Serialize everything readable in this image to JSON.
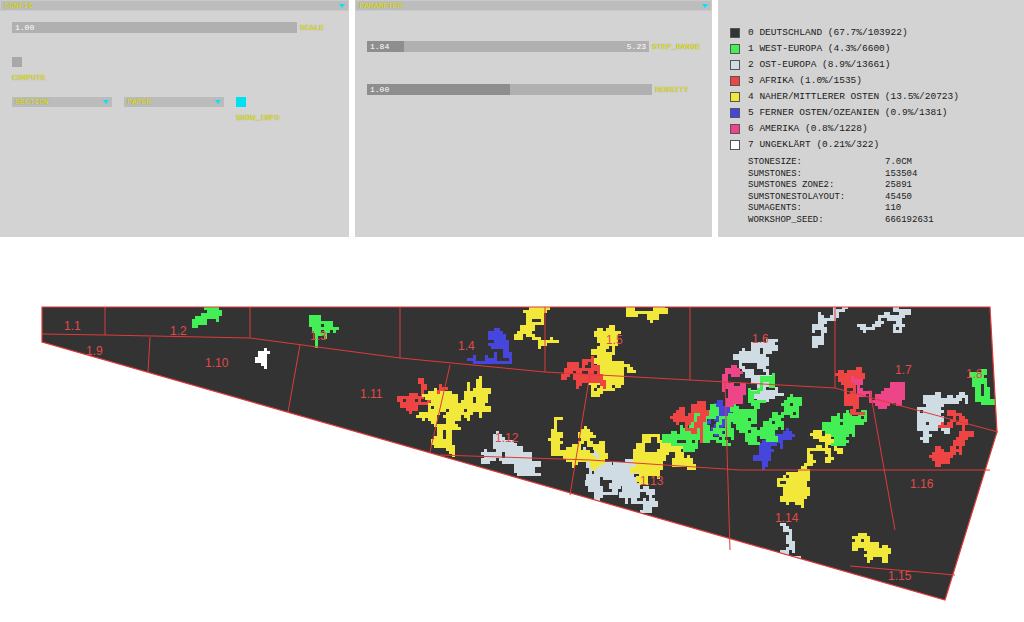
{
  "config": {
    "title": "CONFIG",
    "scale": {
      "label": "SCALE",
      "reading": "1.00",
      "level": 0
    },
    "compute": {
      "label": "COMPUTE",
      "checked": false
    },
    "dropdowns": [
      {
        "label": "SECTION"
      },
      {
        "label": "PAPER"
      }
    ],
    "show_info": {
      "label": "SHOW_INFO",
      "checked": true
    }
  },
  "parameter": {
    "title": "PARAMETER",
    "step_range": {
      "label": "STEP_RANGE",
      "low": "1.84",
      "high": "5.23",
      "level": 0.13
    },
    "density": {
      "label": "DENSITY",
      "reading": "1.00",
      "level": 0.5
    }
  },
  "legend": [
    {
      "label": "0 DEUTSCHLAND (67.7%/103922)",
      "color": "#333333"
    },
    {
      "label": "1 WEST-EUROPA (4.3%/6600)",
      "color": "#44ee55"
    },
    {
      "label": "2 OST-EUROPA (8.9%/13661)",
      "color": "#d0dce4"
    },
    {
      "label": "3 AFRIKA (1.0%/1535)",
      "color": "#ee4444"
    },
    {
      "label": "4 NAHER/MITTLERER OSTEN (13.5%/20723)",
      "color": "#f2e83a"
    },
    {
      "label": "5 FERNER OSTEN/OZEANIEN (0.9%/1381)",
      "color": "#4646dd"
    },
    {
      "label": "6 AMERIKA (0.8%/1228)",
      "color": "#ee4488"
    },
    {
      "label": "7 UNGEKLÄRT (0.21%/322)",
      "color": "#ffffff"
    }
  ],
  "stats": [
    {
      "name": "STONESIZE:",
      "value": "7.0CM"
    },
    {
      "name": "SUMSTONES:",
      "value": "153504"
    },
    {
      "name": "SUMSTONES ZONE2:",
      "value": "25891"
    },
    {
      "name": "SUMSTONESTOLAYOUT:",
      "value": "45450"
    },
    {
      "name": "SUMAGENTS:",
      "value": "110"
    },
    {
      "name": "WORKSHOP_SEED:",
      "value": "666192631"
    }
  ],
  "map": {
    "zones": [
      "1.1",
      "1.2",
      "1.3",
      "1.4",
      "1.5",
      "1.6",
      "1.7",
      "1.8",
      "1.9",
      "1.10",
      "1.11",
      "1.12",
      "1.13",
      "1.14",
      "1.15",
      "1.16"
    ],
    "clusters": [
      {
        "color": "#44ee55"
      },
      {
        "color": "#44ee55"
      },
      {
        "color": "#44ee55"
      },
      {
        "color": "#ee4444"
      },
      {
        "color": "#ffffff"
      },
      {
        "color": "#d0dce4"
      },
      {
        "color": "#d0dce4"
      },
      {
        "color": "#d0dce4"
      },
      {
        "color": "#d0dce4"
      },
      {
        "color": "#d0dce4"
      },
      {
        "color": "#d0dce4"
      },
      {
        "color": "#d0dce4"
      },
      {
        "color": "#f2e83a"
      },
      {
        "color": "#f2e83a"
      },
      {
        "color": "#f2e83a"
      },
      {
        "color": "#f2e83a"
      },
      {
        "color": "#f2e83a"
      },
      {
        "color": "#f2e83a"
      },
      {
        "color": "#f2e83a"
      },
      {
        "color": "#f2e83a"
      },
      {
        "color": "#4646dd"
      },
      {
        "color": "#4646dd"
      },
      {
        "color": "#4646dd"
      },
      {
        "color": "#44ee55"
      },
      {
        "color": "#44ee55"
      },
      {
        "color": "#44ee55"
      },
      {
        "color": "#ee4444"
      },
      {
        "color": "#ee4444"
      },
      {
        "color": "#ee4444"
      },
      {
        "color": "#ee4444"
      },
      {
        "color": "#ee4488"
      },
      {
        "color": "#ee4488"
      }
    ]
  }
}
